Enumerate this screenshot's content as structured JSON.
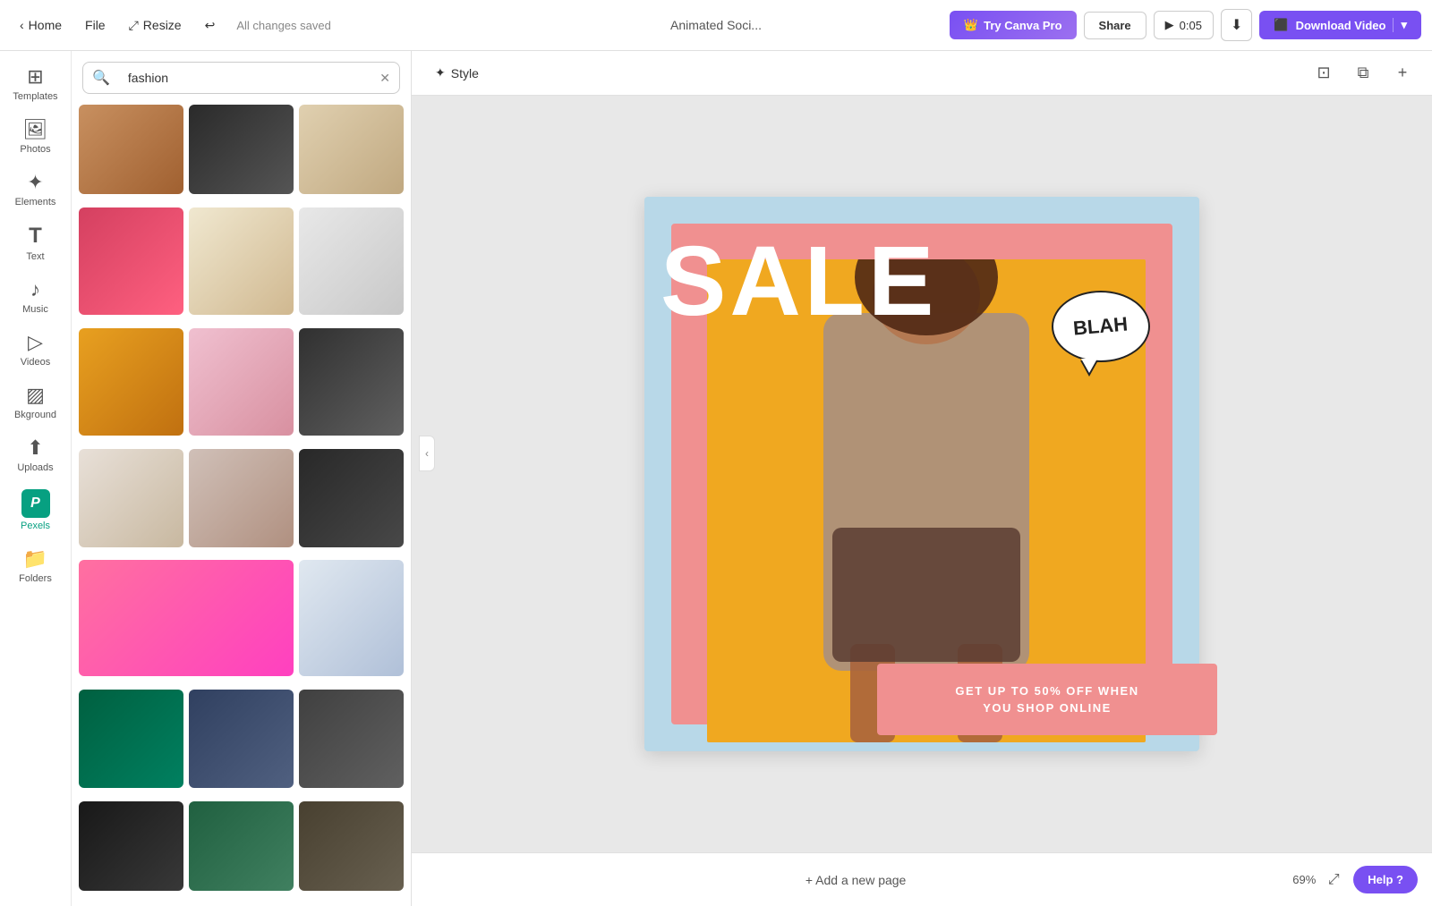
{
  "nav": {
    "home_label": "Home",
    "file_label": "File",
    "resize_label": "Resize",
    "undo_label": "↩",
    "saved_text": "All changes saved",
    "title": "Animated Soci...",
    "try_pro_label": "Try Canva Pro",
    "share_label": "Share",
    "play_time": "0:05",
    "download_video_label": "Download Video"
  },
  "sidebar": {
    "items": [
      {
        "id": "templates",
        "icon": "⊞",
        "label": "Templates"
      },
      {
        "id": "photos",
        "icon": "🖼",
        "label": "Photos"
      },
      {
        "id": "elements",
        "icon": "✦",
        "label": "Elements"
      },
      {
        "id": "text",
        "icon": "T",
        "label": "Text"
      },
      {
        "id": "music",
        "icon": "♪",
        "label": "Music"
      },
      {
        "id": "videos",
        "icon": "▷",
        "label": "Videos"
      },
      {
        "id": "background",
        "icon": "▨",
        "label": "Bkground"
      },
      {
        "id": "uploads",
        "icon": "⬆",
        "label": "Uploads"
      },
      {
        "id": "pexels",
        "icon": "P",
        "label": "Pexels"
      },
      {
        "id": "folders",
        "icon": "📁",
        "label": "Folders"
      }
    ]
  },
  "panel": {
    "search_placeholder": "fashion",
    "search_value": "fashion"
  },
  "toolbar": {
    "style_label": "Style",
    "style_icon": "✦"
  },
  "canvas": {
    "sale_text": "SALE",
    "blah_text": "BLAH",
    "banner_line1": "GET UP TO 50% OFF WHEN",
    "banner_line2": "YOU SHOP ONLINE"
  },
  "bottom_bar": {
    "add_page_label": "+ Add a new page",
    "zoom_level": "69%",
    "help_label": "Help ?"
  }
}
